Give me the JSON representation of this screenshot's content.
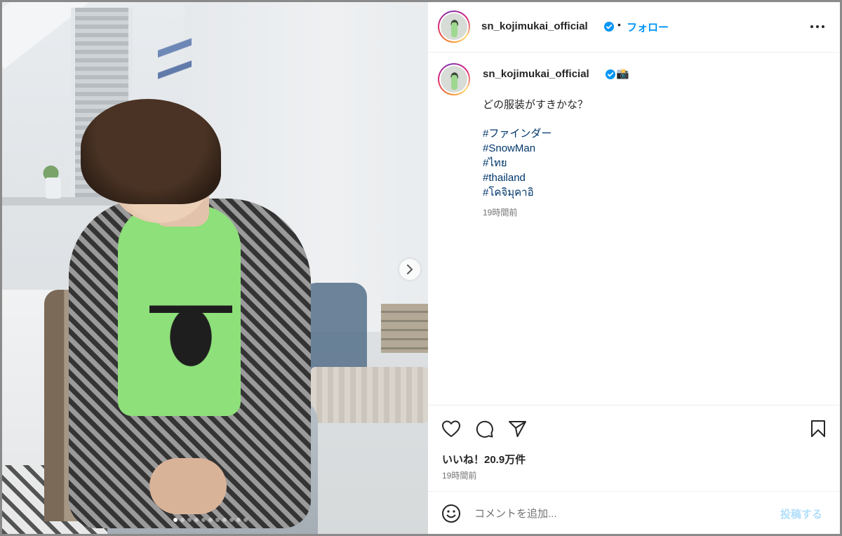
{
  "header": {
    "username": "sn_kojimukai_official",
    "separator": "•",
    "follow_label": "フォロー",
    "more_icon": "more-horizontal-icon"
  },
  "caption": {
    "username": "sn_kojimukai_official",
    "emoji": "📸",
    "text": "どの服装がすきかな？",
    "hashtags": [
      "#ファインダー",
      "#SnowMan",
      "#ไทย",
      "#thailand",
      "#โคจิมุคาอิ"
    ],
    "time": "19時間前"
  },
  "actions": {
    "like_icon": "heart-icon",
    "comment_icon": "comment-icon",
    "share_icon": "send-icon",
    "save_icon": "bookmark-icon",
    "likes": "いいね！20.9万件",
    "time": "19時間前"
  },
  "comment": {
    "placeholder": "コメントを追加...",
    "post_label": "投稿する",
    "emoji_icon": "smiley-icon"
  },
  "carousel": {
    "total_slides": 11,
    "current_slide": 1
  },
  "colors": {
    "link": "#0095f6",
    "hashtag": "#00376b",
    "post_disabled": "#b2dffc",
    "verified": "#0095f6"
  }
}
